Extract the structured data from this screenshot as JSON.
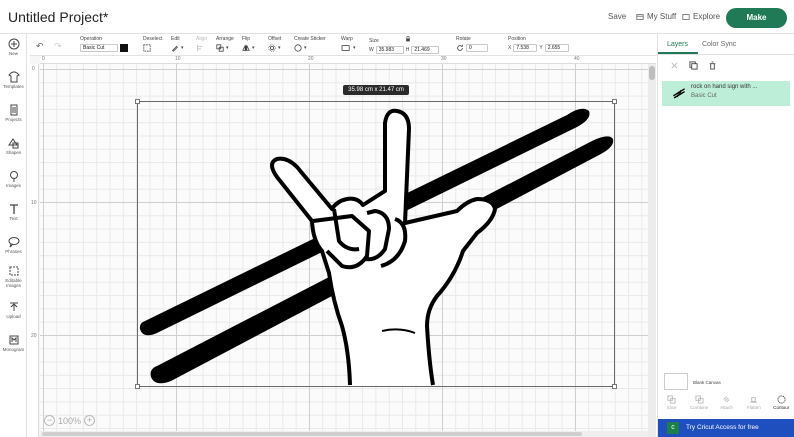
{
  "header": {
    "title": "Untitled Project*",
    "save": "Save",
    "my_stuff": "My Stuff",
    "explore": "Explore",
    "make": "Make"
  },
  "toolbar": {
    "operation_label": "Operation",
    "operation_value": "Basic Cut",
    "deselect": "Deselect",
    "edit": "Edit",
    "align": "Align",
    "arrange": "Arrange",
    "flip": "Flip",
    "offset": "Offset",
    "create_sticker": "Create Sticker",
    "warp": "Warp",
    "size_label": "Size",
    "w_label": "W",
    "w_value": "35.983",
    "h_label": "H",
    "h_value": "21.469",
    "rotate_label": "Rotate",
    "rotate_value": "0",
    "position_label": "Position",
    "x_label": "X",
    "x_value": "7.538",
    "y_label": "Y",
    "y_value": "2.655"
  },
  "leftnav": {
    "items": [
      "New",
      "Templates",
      "Projects",
      "Shapes",
      "Images",
      "Text",
      "Phrases",
      "Editable Images",
      "Upload",
      "Monogram"
    ]
  },
  "rulers": {
    "top": [
      "0",
      "10",
      "20",
      "30",
      "40"
    ],
    "left": [
      "0",
      "10",
      "20"
    ]
  },
  "canvas": {
    "dimension_label": "35.98  cm x 21.47  cm",
    "zoom": "100%"
  },
  "rpanel": {
    "tab_layers": "Layers",
    "tab_color_sync": "Color Sync",
    "layer_name": "rock on hand sign with ...",
    "layer_sub": "Basic Cut",
    "blank_canvas": "Blank Canvas",
    "tools": [
      "Slice",
      "Combine",
      "Attach",
      "Flatten",
      "Contour"
    ],
    "access": "Try Cricut Access for free"
  },
  "colors": {
    "brand_green": "#1f7a55",
    "layer_highlight": "#bdeed8",
    "access_blue": "#1f4fbf"
  }
}
